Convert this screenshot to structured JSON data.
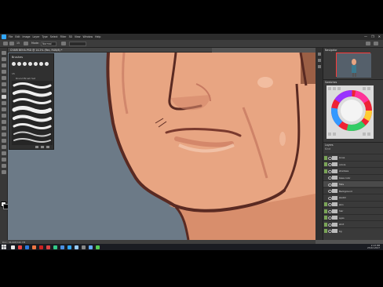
{
  "menubar": {
    "items": [
      "File",
      "Edit",
      "Image",
      "Layer",
      "Type",
      "Select",
      "Filter",
      "3D",
      "View",
      "Window",
      "Help"
    ],
    "controls": [
      "—",
      "❐",
      "✕"
    ]
  },
  "options": {
    "size": "15",
    "mode_label": "Mode:",
    "mode_value": "Normal"
  },
  "document": {
    "tab": "CHARI BEHA.PSD @ 14.2% (Rec, RGB/8) *"
  },
  "brushes_panel": {
    "title": "Brushes",
    "size_value": "15",
    "subtitle": "Round Brush Set"
  },
  "navigator": {
    "title": "Navigator"
  },
  "color_panel": {
    "title": "Swatches"
  },
  "layers_panel": {
    "title": "Layers",
    "kind_label": "Kind",
    "layers": [
      {
        "name": "Lines",
        "color": "#7aa457"
      },
      {
        "name": "colors",
        "color": "#7aa457"
      },
      {
        "name": "shadows",
        "color": "#7aa457"
      },
      {
        "name": "base color",
        "color": ""
      },
      {
        "name": "flats",
        "color": ""
      },
      {
        "name": "Background",
        "color": ""
      },
      {
        "name": "sketch",
        "color": ""
      },
      {
        "name": "skin",
        "color": "#7aa457"
      },
      {
        "name": "hair",
        "color": "#7aa457"
      },
      {
        "name": "eyes",
        "color": "#7aa457"
      },
      {
        "name": "shirt",
        "color": "#7aa457"
      },
      {
        "name": "bg",
        "color": "#7aa457"
      }
    ]
  },
  "status": {
    "text": "Doc: 36.6M/340.7M"
  },
  "taskbar": {
    "time": "2:13 PM",
    "date": "23.02.2017",
    "icon_colors": [
      "#e8e8e8",
      "#e44",
      "#2d7be0",
      "#e74",
      "#cc2222",
      "#d44",
      "#3c8",
      "#4a90e2",
      "#31a8ff",
      "#9cf",
      "#888",
      "#6af",
      "#5c5"
    ]
  },
  "colors": {
    "skin": "#e8a582",
    "skin_shadow": "#c77a62",
    "line": "#5a2a22",
    "canvas_bg": "#6c7a87"
  }
}
